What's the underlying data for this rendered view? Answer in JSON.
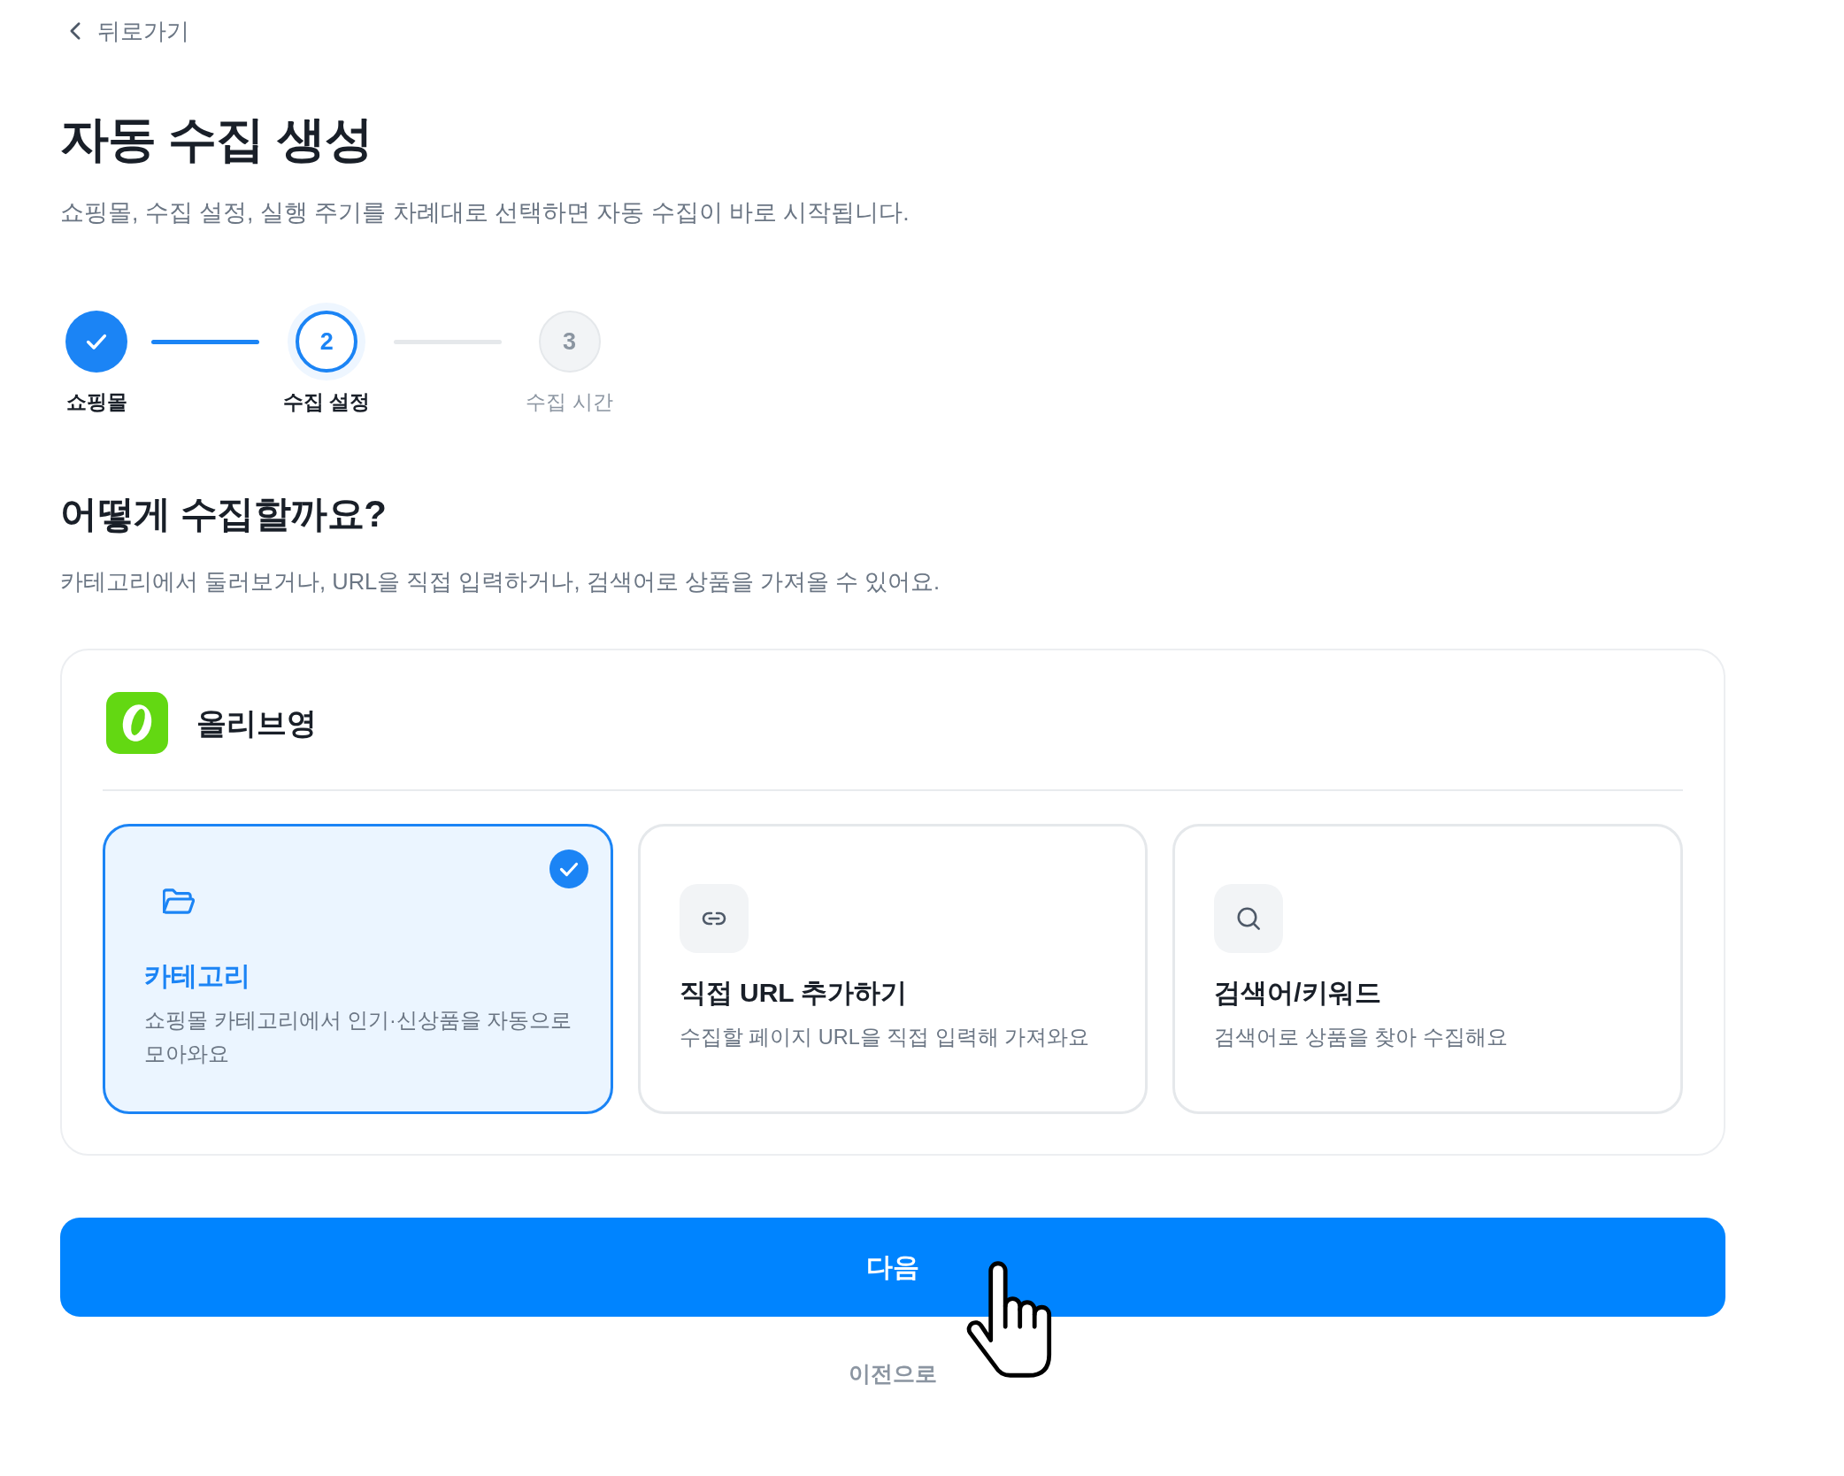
{
  "back_link": {
    "label": "뒤로가기"
  },
  "header": {
    "title": "자동 수집 생성",
    "subtitle": "쇼핑몰, 수집 설정, 실행 주기를 차례대로 선택하면 자동 수집이 바로 시작됩니다."
  },
  "stepper": {
    "steps": [
      {
        "label": "쇼핑몰",
        "completed": true,
        "selected": false
      },
      {
        "number": "2",
        "label": "수집 설정",
        "completed": false,
        "selected": true
      },
      {
        "number": "3",
        "label": "수집 시간",
        "completed": false,
        "selected": false
      }
    ]
  },
  "section": {
    "heading": "어떻게 수집할까요?",
    "description": "카테고리에서 둘러보거나, URL을 직접 입력하거나, 검색어로 상품을 가져올 수 있어요."
  },
  "mall": {
    "name": "올리브영",
    "options": [
      {
        "kind": "category",
        "title": "카테고리",
        "description": "쇼핑몰 카테고리에서 인기·신상품을 자동으로 모아와요",
        "selected": true
      },
      {
        "kind": "url",
        "title": "직접 URL 추가하기",
        "description": "수집할 페이지 URL을 직접 입력해 가져와요",
        "selected": false
      },
      {
        "kind": "keyword",
        "title": "검색어/키워드",
        "description": "검색어로 상품을 찾아 수집해요",
        "selected": false
      }
    ]
  },
  "actions": {
    "next": "다음",
    "previous": "이전으로"
  }
}
